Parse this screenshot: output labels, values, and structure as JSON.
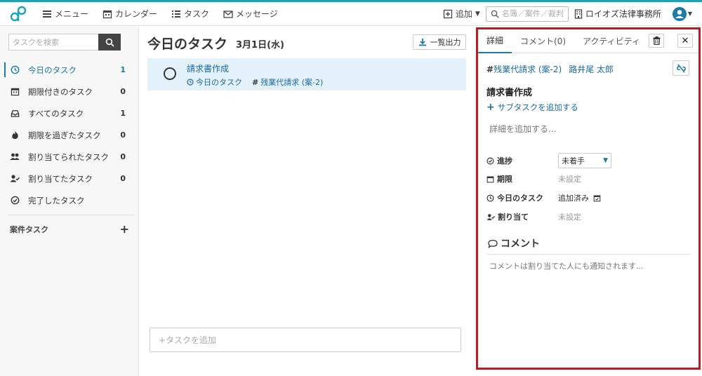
{
  "nav": {
    "menu": "メニュー",
    "calendar": "カレンダー",
    "task": "タスク",
    "message": "メッセージ"
  },
  "topright": {
    "add": "追加",
    "search_placeholder": "名簿／案件／裁判",
    "office": "ロイオズ法律事務所"
  },
  "sidebar": {
    "search_placeholder": "タスクを検索",
    "items": [
      {
        "label": "今日のタスク",
        "count": "1",
        "icon": "clock-icon"
      },
      {
        "label": "期限付きのタスク",
        "count": "0",
        "icon": "calendar-icon"
      },
      {
        "label": "すべてのタスク",
        "count": "1",
        "icon": "inbox-icon"
      },
      {
        "label": "期限を過ぎたタスク",
        "count": "0",
        "icon": "fire-icon"
      },
      {
        "label": "割り当てられたタスク",
        "count": "0",
        "icon": "users-icon"
      },
      {
        "label": "割り当てたタスク",
        "count": "0",
        "icon": "user-check-icon"
      },
      {
        "label": "完了したタスク",
        "count": "",
        "icon": "check-circle-icon"
      }
    ],
    "case_tasks": "案件タスク"
  },
  "main": {
    "title": "今日のタスク",
    "date": "3月1日(水)",
    "export": "一覧出力",
    "task": {
      "name": "請求書作成",
      "list": "今日のタスク",
      "tag": "残業代請求 (案-2)"
    },
    "add_task": "+タスクを追加"
  },
  "detail": {
    "tabs": [
      "詳細",
      "コメント(0)",
      "アクティビティ"
    ],
    "tag": "残業代請求 (案-2)",
    "client": "路井尾 太郎",
    "title": "請求書作成",
    "add_subtask": "サブタスクを追加する",
    "detail_placeholder": "詳細を追加する...",
    "props": {
      "progress_label": "進捗",
      "progress_value": "未着手",
      "deadline_label": "期限",
      "deadline_value": "未設定",
      "today_label": "今日のタスク",
      "today_value": "追加済み",
      "assign_label": "割り当て",
      "assign_value": "未設定"
    },
    "comment_head": "コメント",
    "comment_placeholder": "コメントは割り当てた人にも通知されます..."
  },
  "colors": {
    "accent": "#1a7aa8",
    "highlight_row": "#e3f1fa",
    "detail_border": "#b51f24",
    "top_line": "#1aa3b6"
  }
}
